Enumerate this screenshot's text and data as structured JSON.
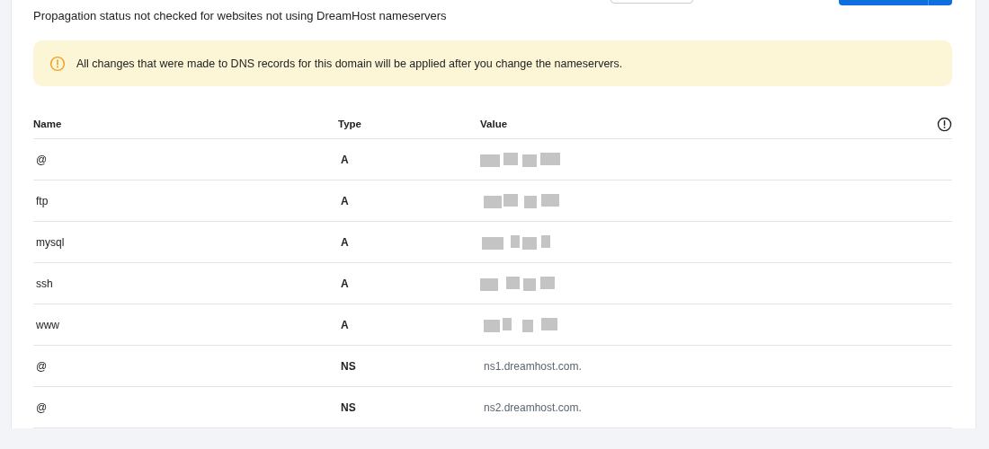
{
  "header": {
    "subtitle": "Propagation status not checked for websites not using DreamHost nameservers"
  },
  "notice": {
    "text": "All changes that were made to DNS records for this domain will be applied after you change the nameservers."
  },
  "table": {
    "columns": [
      "Name",
      "Type",
      "Value"
    ],
    "rows": [
      {
        "name": "@",
        "type": "A",
        "redacted": true
      },
      {
        "name": "ftp",
        "type": "A",
        "redacted": true
      },
      {
        "name": "mysql",
        "type": "A",
        "redacted": true
      },
      {
        "name": "ssh",
        "type": "A",
        "redacted": true
      },
      {
        "name": "www",
        "type": "A",
        "redacted": true
      },
      {
        "name": "@",
        "type": "NS",
        "redacted": false,
        "value": "ns1.dreamhost.com."
      },
      {
        "name": "@",
        "type": "NS",
        "redacted": false,
        "value": "ns2.dreamhost.com."
      }
    ]
  }
}
